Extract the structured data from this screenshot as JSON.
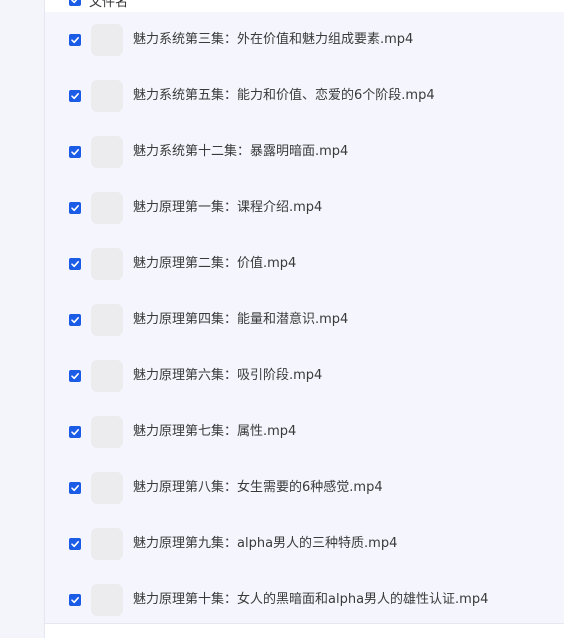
{
  "header": {
    "label": "文件名",
    "checked": true
  },
  "colors": {
    "checkbox": "#1a5ce5",
    "list_background": "#f5f6fd",
    "thumb_background": "#ececef"
  },
  "files": [
    {
      "name": "魅力系统第三集：外在价值和魅力组成要素.mp4",
      "checked": true,
      "icon": "video-file-icon"
    },
    {
      "name": "魅力系统第五集：能力和价值、恋爱的6个阶段.mp4",
      "checked": true,
      "icon": "video-file-icon"
    },
    {
      "name": "魅力系统第十二集：暴露明暗面.mp4",
      "checked": true,
      "icon": "video-file-icon"
    },
    {
      "name": "魅力原理第一集：课程介绍.mp4",
      "checked": true,
      "icon": "video-file-icon"
    },
    {
      "name": "魅力原理第二集：价值.mp4",
      "checked": true,
      "icon": "video-file-icon"
    },
    {
      "name": "魅力原理第四集：能量和潜意识.mp4",
      "checked": true,
      "icon": "video-file-icon"
    },
    {
      "name": "魅力原理第六集：吸引阶段.mp4",
      "checked": true,
      "icon": "video-file-icon"
    },
    {
      "name": "魅力原理第七集：属性.mp4",
      "checked": true,
      "icon": "video-file-icon"
    },
    {
      "name": "魅力原理第八集：女生需要的6种感觉.mp4",
      "checked": true,
      "icon": "video-file-icon"
    },
    {
      "name": "魅力原理第九集：alpha男人的三种特质.mp4",
      "checked": true,
      "icon": "video-file-icon"
    },
    {
      "name": "魅力原理第十集：女人的黑暗面和alpha男人的雄性认证.mp4",
      "checked": true,
      "icon": "video-file-icon"
    }
  ]
}
